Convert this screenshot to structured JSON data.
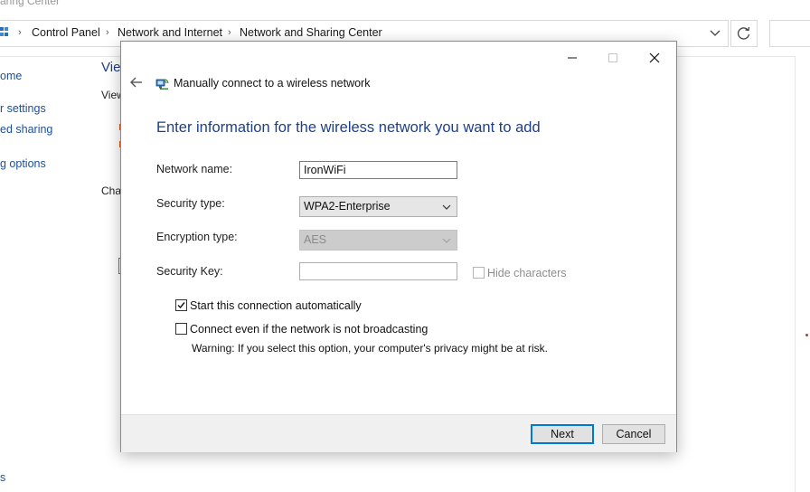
{
  "background": {
    "title_fragment": "aring Center",
    "breadcrumbs": [
      "Control Panel",
      "Network and Internet",
      "Network and Sharing Center"
    ],
    "sidebar_fragments": [
      "ome",
      "r settings",
      "ed sharing",
      "g options",
      "s"
    ],
    "main_fragments": [
      "Vie",
      "View",
      "Cha"
    ]
  },
  "dialog": {
    "title": "Manually connect to a wireless network",
    "heading": "Enter information for the wireless network you want to add",
    "fields": {
      "network_name_label": "Network name:",
      "network_name_value": "IronWiFi",
      "security_type_label": "Security type:",
      "security_type_value": "WPA2-Enterprise",
      "encryption_type_label": "Encryption type:",
      "encryption_type_value": "AES",
      "security_key_label": "Security Key:",
      "security_key_value": "",
      "hide_characters_label": "Hide characters"
    },
    "options": {
      "start_auto_label": "Start this connection automatically",
      "start_auto_checked": true,
      "connect_hidden_label": "Connect even if the network is not broadcasting",
      "connect_hidden_checked": false,
      "warning": "Warning: If you select this option, your computer's privacy might be at risk."
    },
    "buttons": {
      "next": "Next",
      "cancel": "Cancel"
    }
  }
}
